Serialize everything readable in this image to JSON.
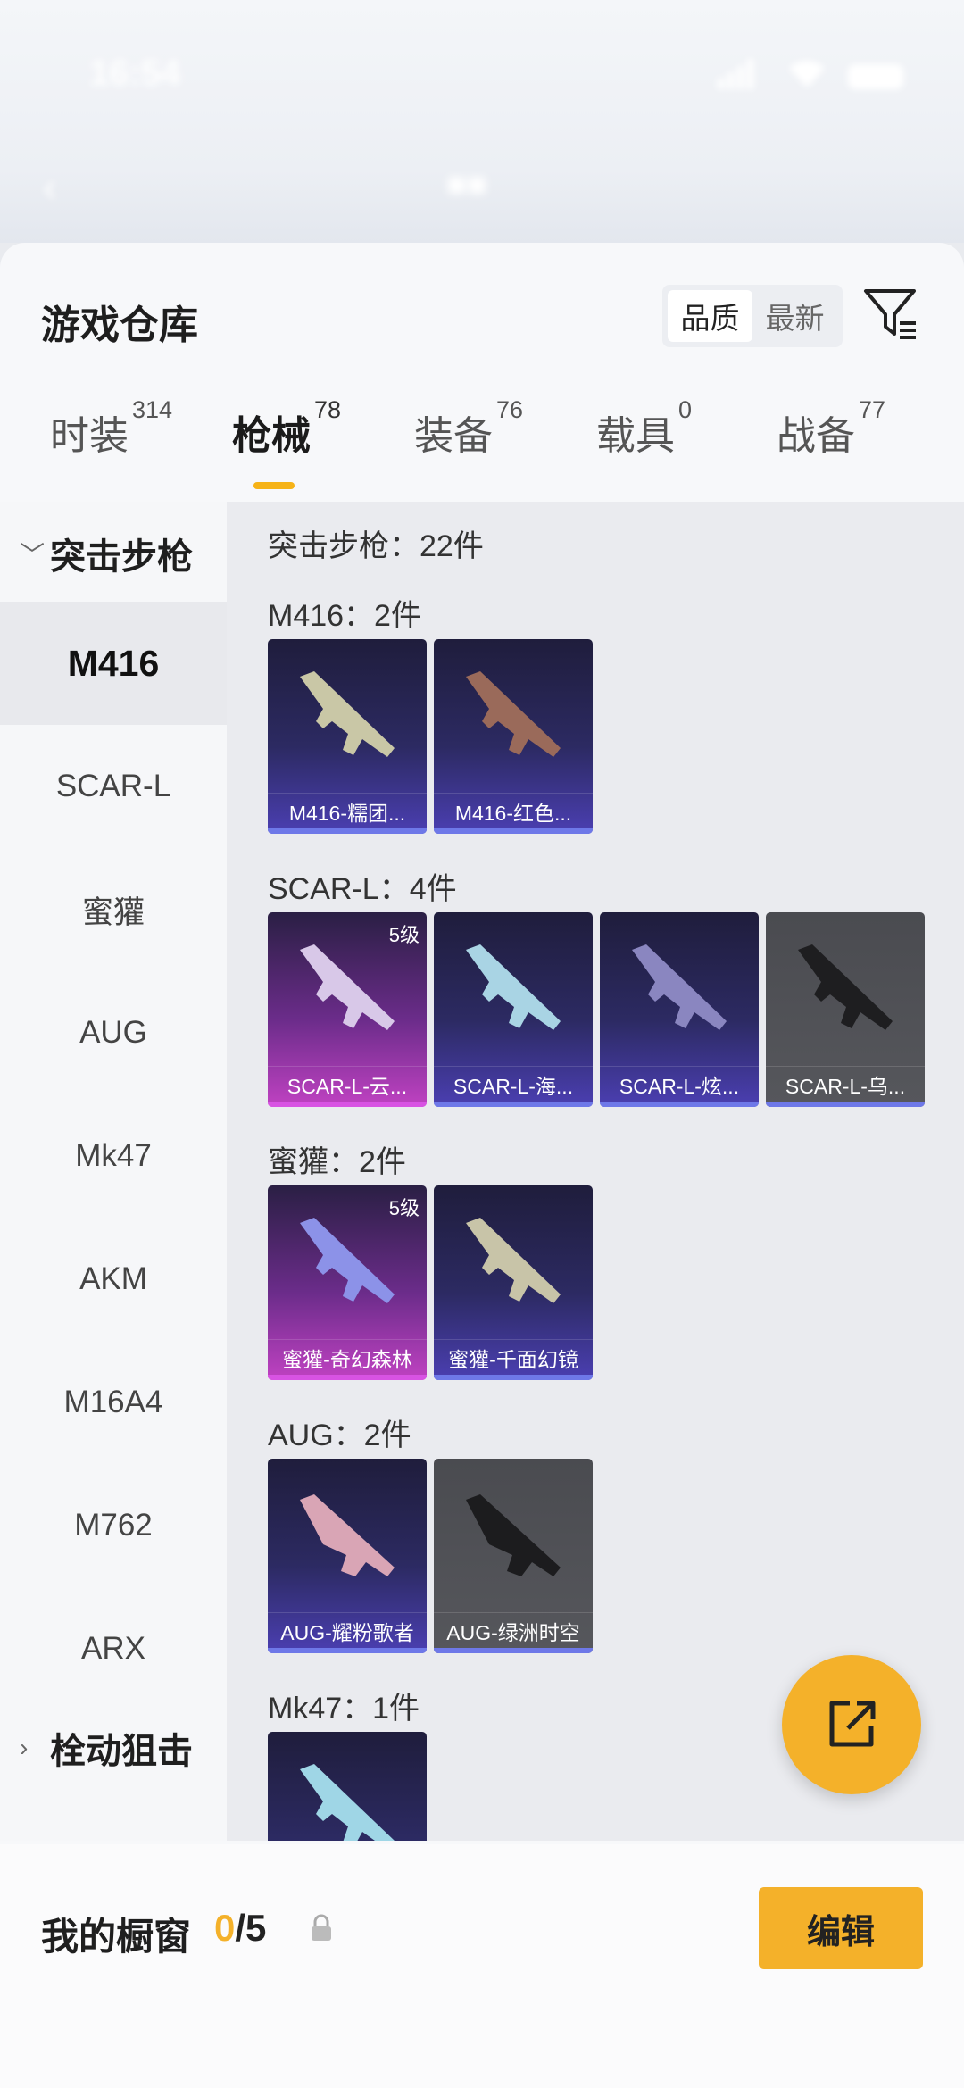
{
  "status_bar": {
    "time": "16:54"
  },
  "sheet": {
    "title": "游戏仓库",
    "sort": {
      "options": [
        "品质",
        "最新"
      ],
      "selected": "品质"
    }
  },
  "tabs": [
    {
      "label": "时装",
      "count": "314"
    },
    {
      "label": "枪械",
      "count": "78"
    },
    {
      "label": "装备",
      "count": "76"
    },
    {
      "label": "载具",
      "count": "0"
    },
    {
      "label": "战备",
      "count": "77"
    }
  ],
  "active_tab": "枪械",
  "sidebar": {
    "categories": [
      {
        "label": "突击步枪",
        "expanded": true
      },
      {
        "label": "栓动狙击",
        "expanded": false
      }
    ],
    "items": [
      "M416",
      "SCAR-L",
      "蜜獾",
      "AUG",
      "Mk47",
      "AKM",
      "M16A4",
      "M762",
      "ARX"
    ],
    "active_item": "M416"
  },
  "content": {
    "total_title": "突击步枪：22件",
    "groups": [
      {
        "title": "M416：2件",
        "cards": [
          {
            "label": "M416-糯团...",
            "style": "blue"
          },
          {
            "label": "M416-红色...",
            "style": "blue"
          }
        ]
      },
      {
        "title": "SCAR-L：4件",
        "cards": [
          {
            "label": "SCAR-L-云...",
            "style": "pink",
            "level": "5级"
          },
          {
            "label": "SCAR-L-海...",
            "style": "blue"
          },
          {
            "label": "SCAR-L-炫...",
            "style": "blue"
          },
          {
            "label": "SCAR-L-乌...",
            "style": "gray"
          }
        ]
      },
      {
        "title": "蜜獾：2件",
        "cards": [
          {
            "label": "蜜獾-奇幻森林",
            "style": "pink",
            "level": "5级"
          },
          {
            "label": "蜜獾-千面幻镜",
            "style": "blue"
          }
        ]
      },
      {
        "title": "AUG：2件",
        "cards": [
          {
            "label": "AUG-耀粉歌者",
            "style": "blue"
          },
          {
            "label": "AUG-绿洲时空",
            "style": "gray"
          }
        ]
      },
      {
        "title": "Mk47：1件",
        "cards": [
          {
            "label": "",
            "style": "blue"
          }
        ]
      }
    ]
  },
  "bottom_bar": {
    "showcase_label": "我的橱窗",
    "showcase_current": "0",
    "showcase_total": "/5",
    "edit_label": "编辑"
  },
  "icons": {
    "filter": "filter-icon",
    "share": "share-export-icon",
    "lock": "lock-icon"
  },
  "colors": {
    "accent": "#f4b12a",
    "blue_card": "#2c2a62",
    "pink_card": "#c042c2",
    "gray_card": "#56575c"
  }
}
